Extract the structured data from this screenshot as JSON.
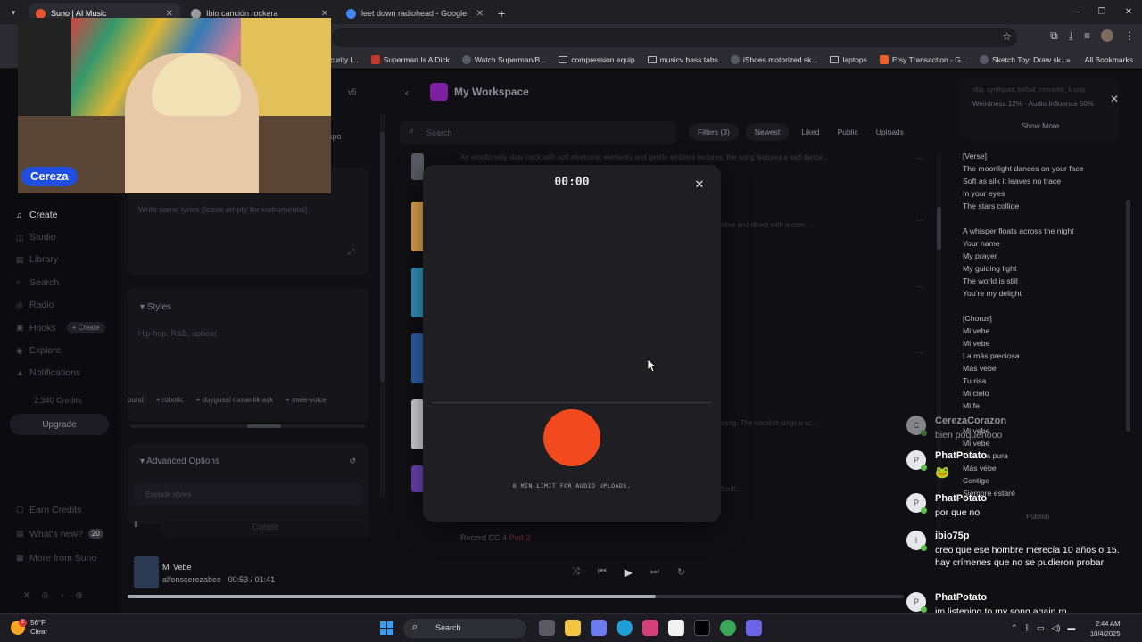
{
  "browser": {
    "tabs": [
      {
        "title": "Suno | AI Music",
        "active": true,
        "favicon_color": "#e8542d"
      },
      {
        "title": "Ibio canción rockera",
        "active": false,
        "favicon_color": "#9a9aa0"
      },
      {
        "title": "leet down radiohead - Google",
        "active": false,
        "favicon_color": "#4285f4"
      }
    ],
    "bookmarks": [
      {
        "label": "curity l..."
      },
      {
        "label": "Superman Is A Dick"
      },
      {
        "label": "Watch Superman/B..."
      },
      {
        "label": "compression equip"
      },
      {
        "label": "musicv bass tabs"
      },
      {
        "label": "iShoes motorized sk..."
      },
      {
        "label": "laptops"
      },
      {
        "label": "Etsy Transaction - G..."
      },
      {
        "label": "Sketch Toy: Draw sk..."
      }
    ],
    "all_bookmarks": "All Bookmarks"
  },
  "sidebar": {
    "items": [
      {
        "label": "Create",
        "icon": "music-note-icon",
        "active": true
      },
      {
        "label": "Studio",
        "icon": "studio-icon"
      },
      {
        "label": "Library",
        "icon": "library-icon"
      },
      {
        "label": "Search",
        "icon": "search-icon"
      },
      {
        "label": "Radio",
        "icon": "radio-icon"
      },
      {
        "label": "Hooks",
        "icon": "hooks-icon"
      },
      {
        "label": "Explore",
        "icon": "explore-icon"
      },
      {
        "label": "Notifications",
        "icon": "bell-icon"
      }
    ],
    "hooks_create": "+ Create",
    "credits": "2,340 Credits",
    "upgrade": "Upgrade",
    "lower_items": [
      {
        "label": "Earn Credits"
      },
      {
        "label": "What's new?",
        "badge": "20"
      },
      {
        "label": "More from Suno"
      }
    ]
  },
  "editor": {
    "version": "v5",
    "tab_spo": "spo",
    "lyrics_placeholder": "Write some lyrics (leave empty for instrumental)",
    "styles_label": "Styles",
    "styles_value": "Hip-hop, R&B, upbeat",
    "chips": [
      "ound",
      "+ robotic",
      "+ duygusal romantik aşk",
      "+ male-voice"
    ],
    "advanced_label": "Advanced Options",
    "exclude_placeholder": "Exclude styles",
    "create_label": "Create"
  },
  "workspace": {
    "title": "My Workspace",
    "search_placeholder": "Search",
    "filters": "Filters (3)",
    "sort": "Newest",
    "tabs": [
      "Liked",
      "Public",
      "Uploads"
    ],
    "rows": [
      {
        "desc": "An emotionally slow track with soft electronic elements and gentle ambient textures, the song features a sad dance...",
        "color": "#5a5a62"
      },
      {
        "desc": "slow and direct with a com...",
        "color": "#d9a04a"
      },
      {
        "desc": "",
        "color": "#2d8fb8"
      },
      {
        "desc": "",
        "color": "#2c5fa6"
      },
      {
        "desc": "song. The vocalist sings a w...",
        "color": "#cfcfd4"
      },
      {
        "desc": "ficult...",
        "color": "#6a3fb0"
      }
    ],
    "last_row": "Record CC 4",
    "last_row_badge": "Part 2"
  },
  "modal": {
    "timer": "00:00",
    "limit_text": "8 MIN LIMIT FOR AUDIO UPLOADS.",
    "record_color": "#f24a1e"
  },
  "details": {
    "tags": "r&b, synthpad, ballad, romantic, k-pop",
    "weirdness": "Weirdness 12% · Audio Influence 50%",
    "show_more": "Show More",
    "lyrics": "[Verse]\nThe moonlight dances on your face\nSoft as silk it leaves no trace\nIn your eyes\nThe stars collide\n\nA whisper floats across the night\nYour name\nMy prayer\nMy guiding light\nThe world is still\nYou're my delight\n\n[Chorus]\nMi vebe\nMi vebe\nLa más preciosa\nMás vebe\nTu risa\nMi cielo\nMi fe\n\nMi vebe\nMi vebe\nTu alma pura\nMás vebe\nContigo\nSiempre estaré",
    "publish": "Publish"
  },
  "player": {
    "title": "Mi Vebe",
    "artist": "alfonscerezabee",
    "time_current": "00:53",
    "time_total": "01:41",
    "progress": 0.68
  },
  "stream": {
    "cam_name": "Cereza",
    "chat": [
      {
        "user": "CerezaCorazon",
        "text": "bien poqueñooo",
        "initial": "C"
      },
      {
        "user": "PhatPotato",
        "text": "",
        "initial": "P"
      },
      {
        "user": "PhatPotato",
        "text": "por que no",
        "initial": "P"
      },
      {
        "user": "ibio75p",
        "text": "creo que ese hombre merecía 10 años o 15. hay crímenes que no se pudieron probar",
        "initial": "I"
      },
      {
        "user": "PhatPotato",
        "text": "im listening to my song again rn",
        "initial": "P"
      }
    ]
  },
  "taskbar": {
    "temperature": "56°F",
    "condition": "Clear",
    "search": "Search",
    "time": "2:44 AM",
    "date": "10/4/2025",
    "weather_badge": "2"
  }
}
